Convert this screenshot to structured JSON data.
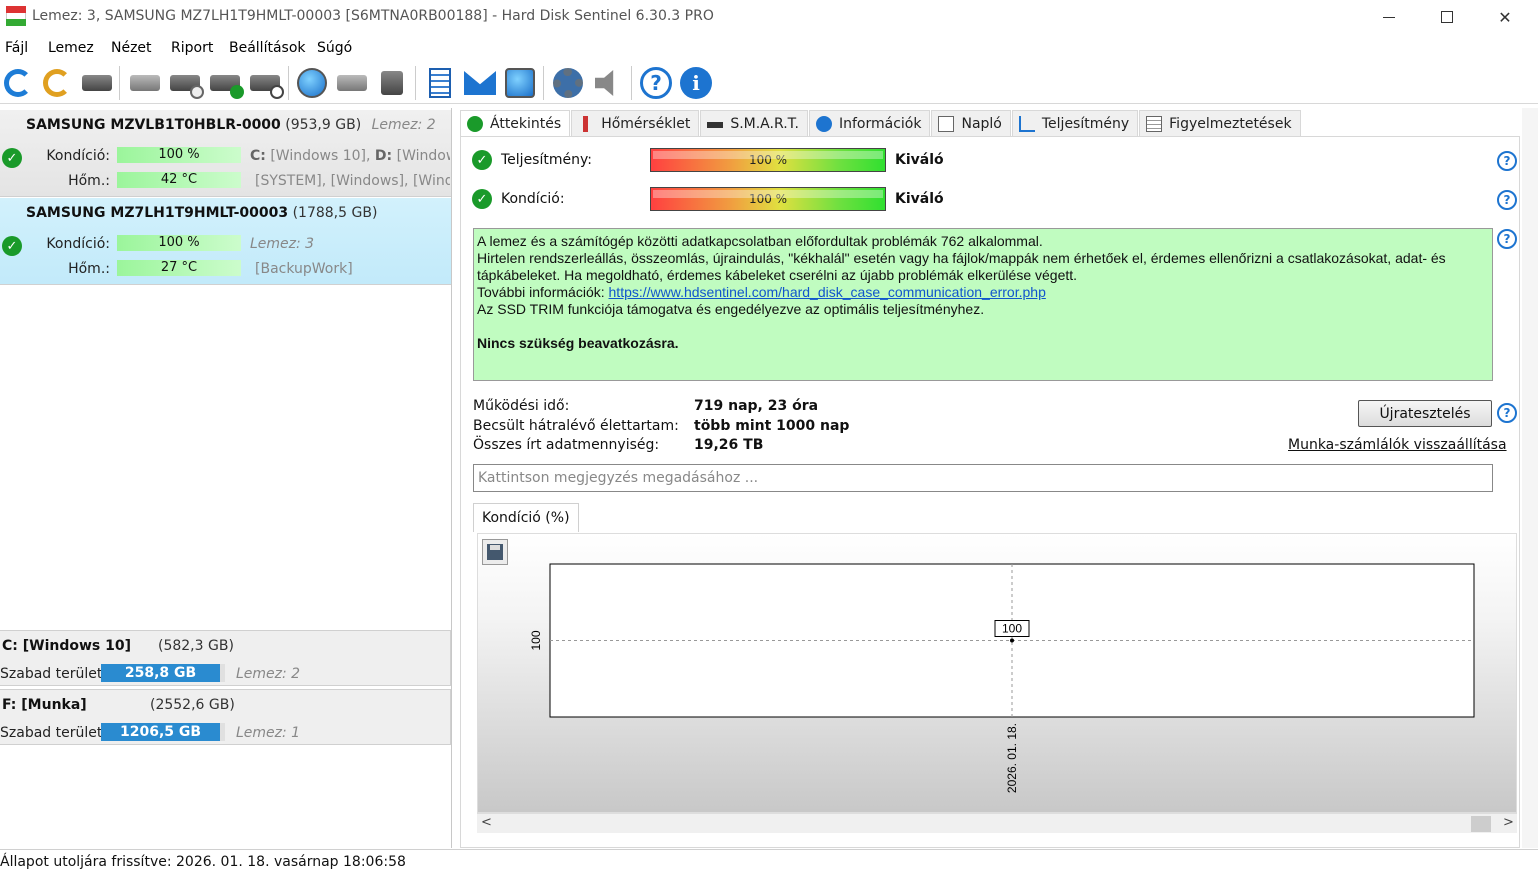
{
  "window": {
    "title": "Lemez: 3, SAMSUNG MZ7LH1T9HMLT-00003 [S6MTNA0RB00188]  -  Hard Disk Sentinel 6.30.3 PRO",
    "minimize_glyph": "—",
    "close_glyph": "✕"
  },
  "menu": {
    "items": [
      "Fájl",
      "Lemez",
      "Nézet",
      "Riport",
      "Beállítások",
      "Súgó"
    ]
  },
  "toolbar": {
    "icons": [
      "refresh-icon",
      "refresh-warning-icon",
      "disk-list-icon",
      "disk-health-icon",
      "disk-schedule-icon",
      "disk-check-icon",
      "disk-search-icon",
      "globe-icon",
      "network-disk-icon",
      "usb-disk-icon",
      "report-icon",
      "mail-icon",
      "web-icon",
      "settings-icon",
      "sound-icon",
      "help-icon",
      "info-icon"
    ],
    "help_glyph": "?",
    "info_glyph": "i"
  },
  "disks": [
    {
      "name": "SAMSUNG MZVLB1T0HBLR-0000",
      "size": "(953,9 GB)",
      "disk_num": "Lemez: 2",
      "health_label": "Kondíció:",
      "health_value": "100 %",
      "temp_label": "Hőm.:",
      "temp_value": "42 °C",
      "vol_line1_a": "C:",
      "vol_line1_b": " [Windows 10], ",
      "vol_line1_c": "D:",
      "vol_line1_d": " [Windows",
      "vol_line2": "[SYSTEM], [Windows], [Wind"
    },
    {
      "name": "SAMSUNG MZ7LH1T9HMLT-00003",
      "size": "(1788,5 GB)",
      "health_label": "Kondíció:",
      "health_value": "100 %",
      "disk_num": "Lemez: 3",
      "temp_label": "Hőm.:",
      "temp_value": "27 °C",
      "vol_line2": "[BackupWork]"
    }
  ],
  "volumes": [
    {
      "name": "C: [Windows 10]",
      "size": "(582,3 GB)",
      "free_label": "Szabad terület",
      "free_value": "258,8 GB",
      "disk": "Lemez: 2"
    },
    {
      "name": "F: [Munka]",
      "size": "(2552,6 GB)",
      "free_label": "Szabad terület",
      "free_value": "1206,5 GB",
      "disk": "Lemez: 1"
    }
  ],
  "tabs": [
    "Áttekintés",
    "Hőmérséklet",
    "S.M.A.R.T.",
    "Információk",
    "Napló",
    "Teljesítmény",
    "Figyelmeztetések"
  ],
  "overview": {
    "performance_label": "Teljesítmény:",
    "performance_value": "100 %",
    "performance_rating": "Kiváló",
    "health_label": "Kondíció:",
    "health_value": "100 %",
    "health_rating": "Kiváló",
    "check_glyph": "✓",
    "msg_line1": "A lemez és a számítógép közötti adatkapcsolatban előfordultak problémák 762 alkalommal.",
    "msg_line2": "Hirtelen rendszerleállás, összeomlás, újraindulás, \"kékhalál\" esetén vagy ha fájlok/mappák nem érhetőek el, érdemes ellenőrizni a csatlakozásokat, adat- és tápkábeleket. Ha megoldható, érdemes kábeleket cserélni az újabb problémák elkerülése végett.",
    "msg_more_label": "További információk: ",
    "msg_link": "https://www.hdsentinel.com/hard_disk_case_communication_error.php",
    "msg_line4": "Az SSD TRIM funkciója támogatva és engedélyezve az optimális teljesítményhez.",
    "msg_bold": "Nincs szükség beavatkozásra.",
    "uptime_label": "Működési idő:",
    "uptime_value": "719 nap, 23 óra",
    "lifetime_label": "Becsült hátralévő élettartam:",
    "lifetime_value": "több mint 1000 nap",
    "written_label": "Összes írt adatmennyiség:",
    "written_value": "19,26 TB",
    "retest_button": "Újratesztelés",
    "reset_link": "Munka-számlálók visszaállítása",
    "note_placeholder": "Kattintson megjegyzés megadásához ...",
    "chart_tab": "Kondíció  (%)",
    "scroll_left": "<",
    "scroll_right": ">"
  },
  "chart_data": {
    "type": "line",
    "title": "",
    "x": [
      "2026. 01. 18."
    ],
    "series": [
      {
        "values": [
          100
        ]
      }
    ],
    "data_labels": [
      "100"
    ],
    "yticks": [
      "100"
    ],
    "ylim": [
      99,
      101
    ],
    "grid": true
  },
  "status": {
    "text": "Állapot utoljára frissítve: 2026. 01. 18. vasárnap 18:06:58"
  }
}
